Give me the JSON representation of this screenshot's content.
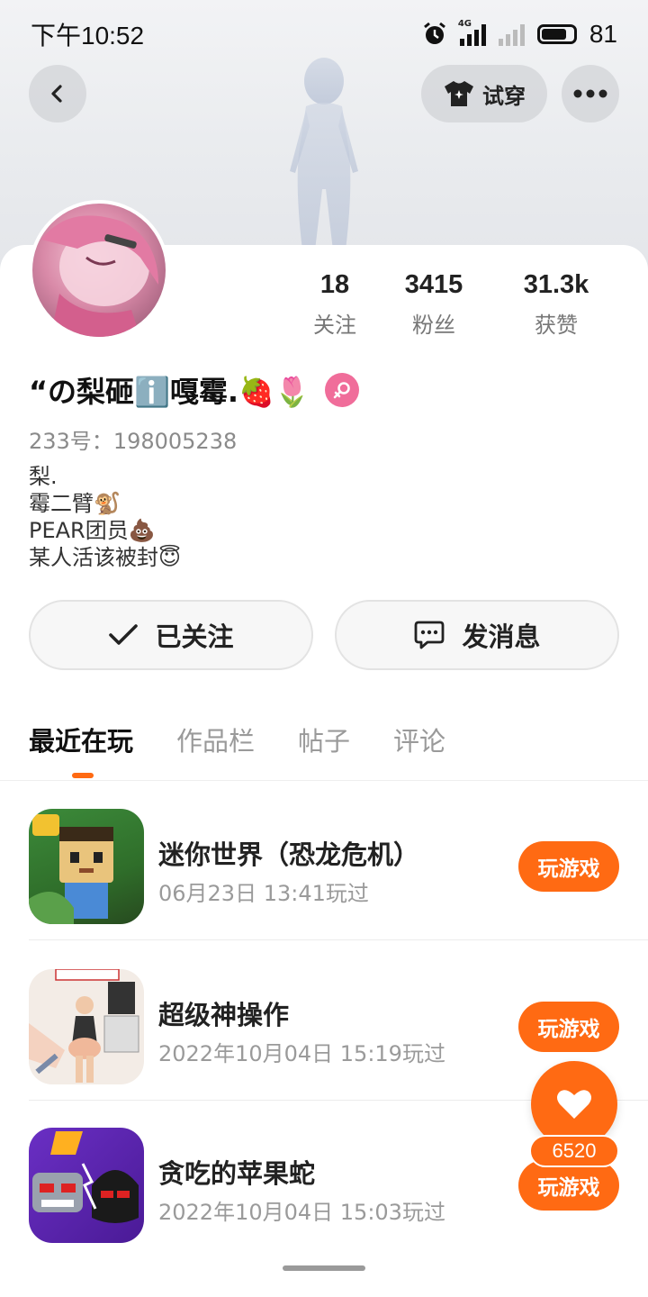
{
  "status_bar": {
    "time": "下午10:52",
    "battery": "81",
    "network": "4G"
  },
  "top_nav": {
    "back_icon": "back-arrow-icon",
    "tryon_label": "试穿",
    "more_icon": "more-dots-icon"
  },
  "profile": {
    "nickname": "“の梨砸ℹ️嘎霉.🍓🌷",
    "uid_label": "233号：",
    "uid_value": "198005238",
    "bio_lines": [
      "梨.",
      "霉二臂🐒",
      "PEAR团员💩",
      "某人活该被封😇"
    ],
    "stats": [
      {
        "value": "18",
        "label": "关注"
      },
      {
        "value": "3415",
        "label": "粉丝"
      },
      {
        "value": "31.3k",
        "label": "获赞"
      }
    ]
  },
  "actions": {
    "follow_label": "已关注",
    "message_label": "发消息"
  },
  "tabs": [
    "最近在玩",
    "作品栏",
    "帖子",
    "评论"
  ],
  "games": [
    {
      "title": "迷你世界（恐龙危机）",
      "time": "06月23日 13:41玩过",
      "button": "玩游戏"
    },
    {
      "title": "超级神操作",
      "time": "2022年10月04日 15:19玩过",
      "button": "玩游戏"
    },
    {
      "title": "贪吃的苹果蛇",
      "time": "2022年10月04日 15:03玩过",
      "button": "玩游戏"
    }
  ],
  "floating_like": {
    "count": "6520"
  },
  "colors": {
    "accent": "#ff6a13",
    "gender_female": "#f06d9a"
  }
}
